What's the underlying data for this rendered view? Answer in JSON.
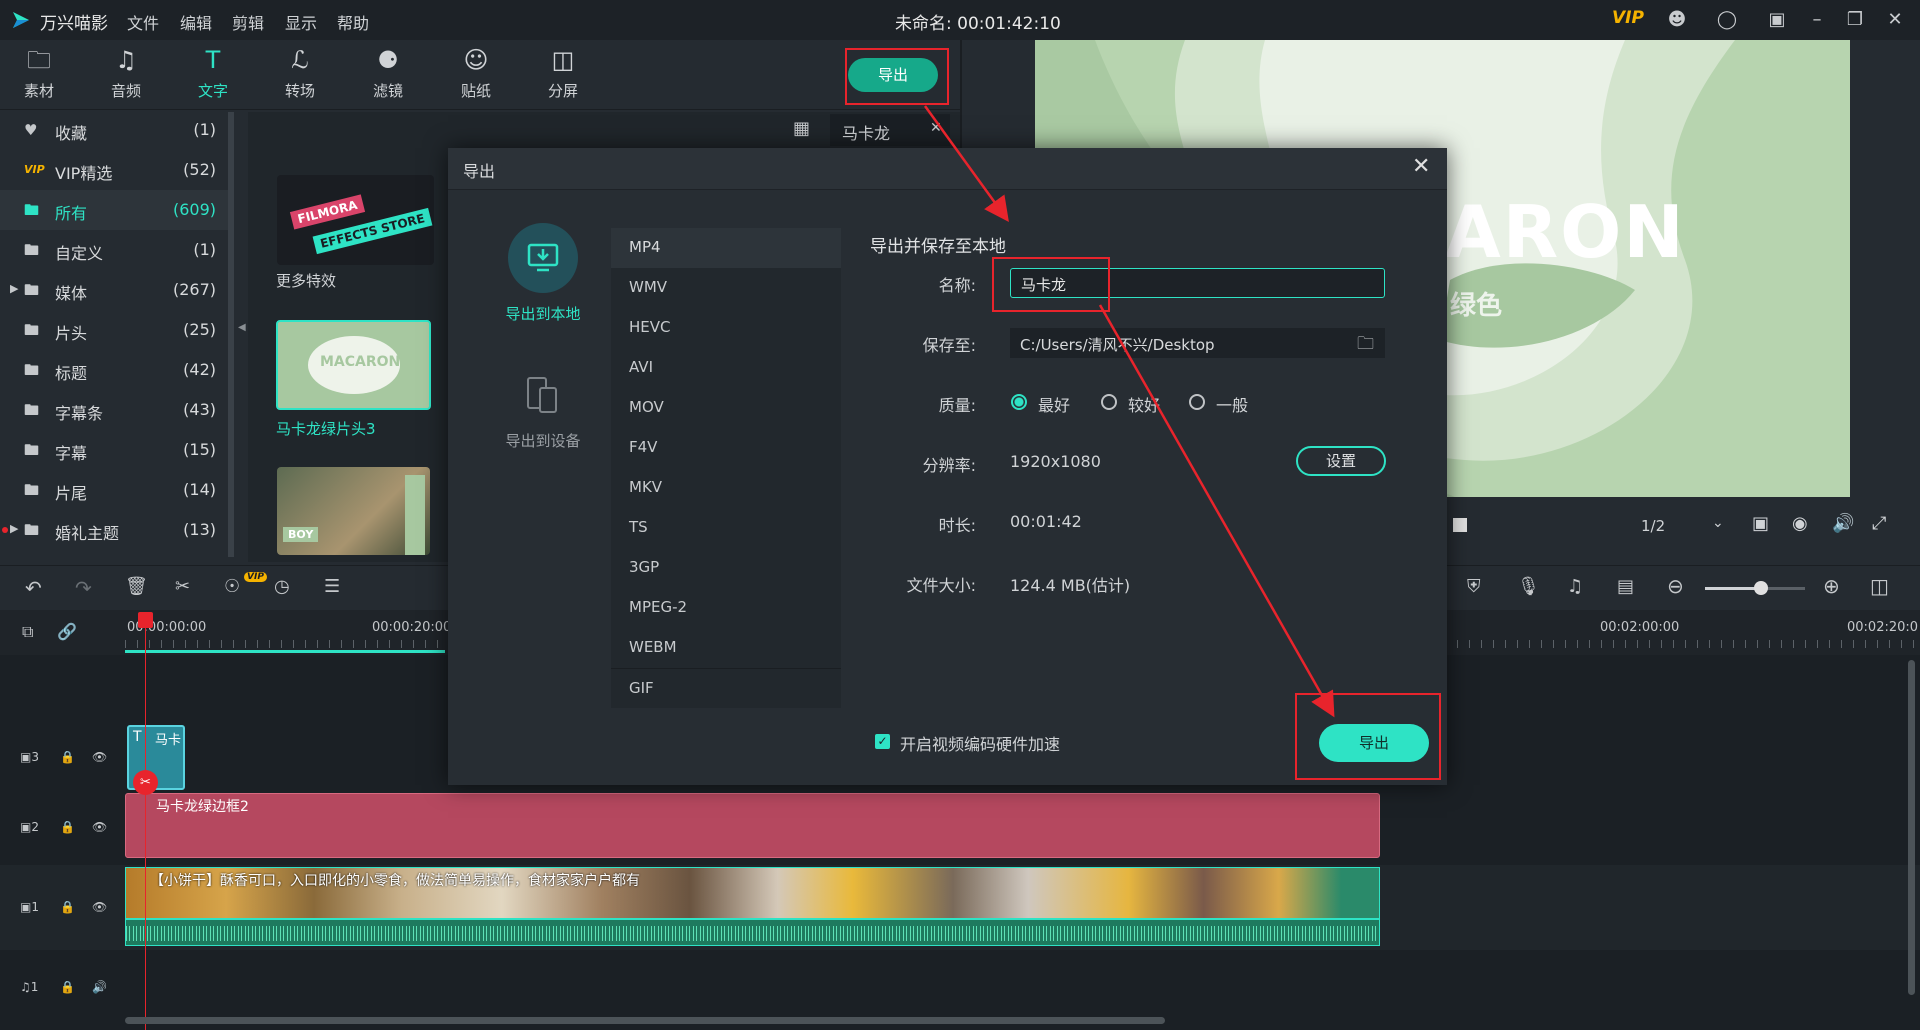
{
  "titlebar": {
    "app_name": "万兴喵影",
    "menus": [
      "文件",
      "编辑",
      "剪辑",
      "显示",
      "帮助"
    ],
    "doc_title": "未命名: 00:01:42:10",
    "vip": "VIP"
  },
  "toolbar": {
    "tools": [
      {
        "label": "素材",
        "icon": "folder-icon"
      },
      {
        "label": "音频",
        "icon": "music-note-icon"
      },
      {
        "label": "文字",
        "icon": "text-icon",
        "active": true
      },
      {
        "label": "转场",
        "icon": "transition-icon"
      },
      {
        "label": "滤镜",
        "icon": "filter-icon"
      },
      {
        "label": "贴纸",
        "icon": "sticker-icon"
      },
      {
        "label": "分屏",
        "icon": "split-screen-icon"
      }
    ],
    "export_label": "导出"
  },
  "sidebar": {
    "items": [
      {
        "label": "收藏",
        "count": "(1)"
      },
      {
        "label": "VIP精选",
        "count": "(52)"
      },
      {
        "label": "所有",
        "count": "(609)"
      },
      {
        "label": "自定义",
        "count": "(1)"
      },
      {
        "label": "媒体",
        "count": "(267)"
      },
      {
        "label": "片头",
        "count": "(25)"
      },
      {
        "label": "标题",
        "count": "(42)"
      },
      {
        "label": "字幕条",
        "count": "(43)"
      },
      {
        "label": "字幕",
        "count": "(15)"
      },
      {
        "label": "片尾",
        "count": "(14)"
      },
      {
        "label": "婚礼主题",
        "count": "(13)"
      }
    ]
  },
  "assets": {
    "search_value": "马卡龙",
    "items": [
      {
        "label": "更多特效",
        "thumb_text_1": "FILMORA",
        "thumb_text_2": "EFFECTS STORE"
      },
      {
        "label": "马卡龙绿片头3",
        "thumb_text_1": "MACARON"
      },
      {
        "label": "",
        "thumb_text_1": "BOY"
      }
    ]
  },
  "preview": {
    "big_text": "ARON",
    "sub_text": "绿色",
    "page": "1/2"
  },
  "timeline": {
    "ruler_labels": [
      "00:00:00:00",
      "00:00:20:00",
      "00:02:00:00",
      "00:02:20:0"
    ],
    "title_clip": "马卡",
    "title_clip_letter": "T",
    "clip_track2": "马卡龙绿边框2",
    "video_clip": "【小饼干】酥香可口，入口即化的小零食，做法简单易操作，食材家家户户都有",
    "tracks": [
      "3",
      "2",
      "1",
      "1"
    ]
  },
  "modal": {
    "title": "导出",
    "tabs": [
      {
        "label": "导出到本地",
        "active": true
      },
      {
        "label": "导出到设备"
      }
    ],
    "formats": [
      "MP4",
      "WMV",
      "HEVC",
      "AVI",
      "MOV",
      "F4V",
      "MKV",
      "TS",
      "3GP",
      "MPEG-2",
      "WEBM",
      "GIF"
    ],
    "selected_format": "MP4",
    "section_title": "导出并保存至本地",
    "name_label": "名称:",
    "name_value": "马卡龙",
    "save_label": "保存至:",
    "save_path": "C:/Users/清风不兴/Desktop",
    "quality_label": "质量:",
    "quality_options": [
      "最好",
      "较好",
      "一般"
    ],
    "resolution_label": "分辨率:",
    "resolution_value": "1920x1080",
    "settings_button": "设置",
    "duration_label": "时长:",
    "duration_value": "00:01:42",
    "filesize_label": "文件大小:",
    "filesize_value": "124.4 MB(估计)",
    "hw_accel_label": "开启视频编码硬件加速",
    "hw_accel_checked": true,
    "export_button": "导出"
  },
  "colors": {
    "accent": "#2ee3c5",
    "export_green": "#16a98a",
    "annotation_red": "#e8242c",
    "track_pink": "#b5485f",
    "audio_green": "#1e7a5e"
  }
}
